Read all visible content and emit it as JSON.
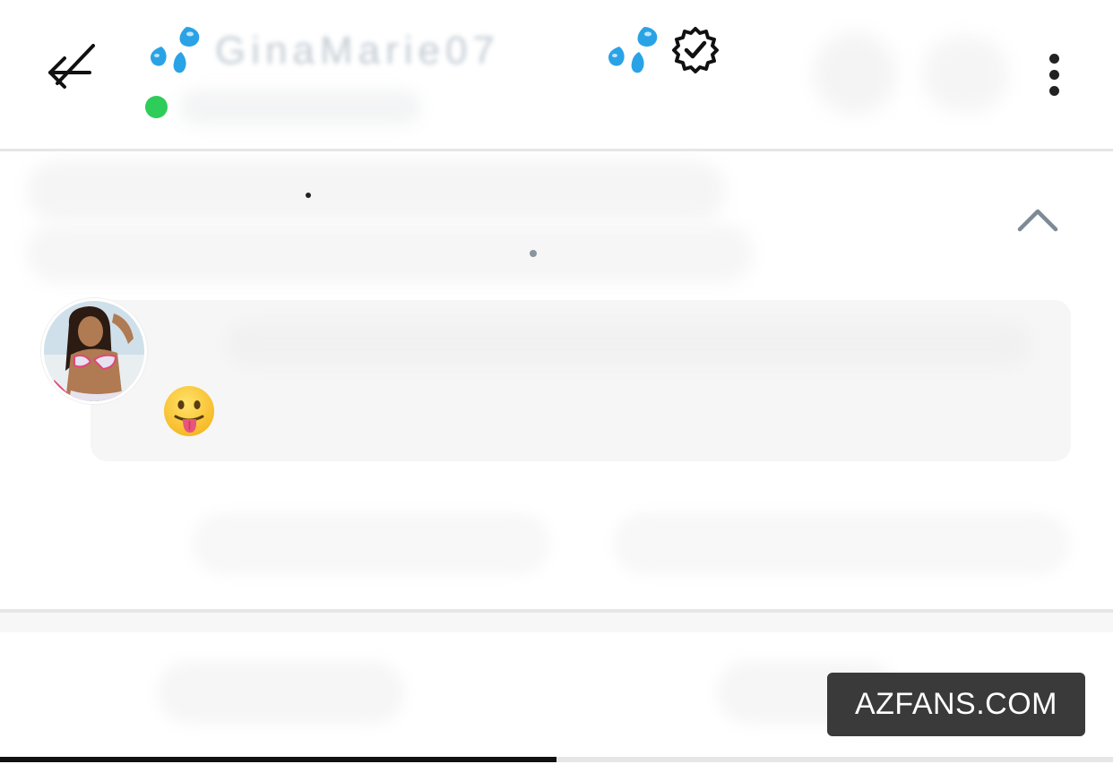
{
  "header": {
    "username": "GinaMarie07",
    "username_icon_left": "sweat-droplets-icon",
    "username_icon_right": "sweat-droplets-icon",
    "verified_icon": "verified-badge-icon",
    "back_icon": "back-arrow-icon",
    "more_icon": "more-vertical-icon",
    "online": true,
    "online_color": "#2ecc58"
  },
  "pinned": {
    "collapse_icon": "chevron-up-icon"
  },
  "message": {
    "avatar": "avatar",
    "emoji": "😛",
    "emoji_icon": "tongue-out-emoji-icon",
    "bubble_color": "#f6f6f6"
  },
  "watermark": {
    "text": "AZFANS.COM"
  },
  "progress": {
    "value": 0.5
  }
}
